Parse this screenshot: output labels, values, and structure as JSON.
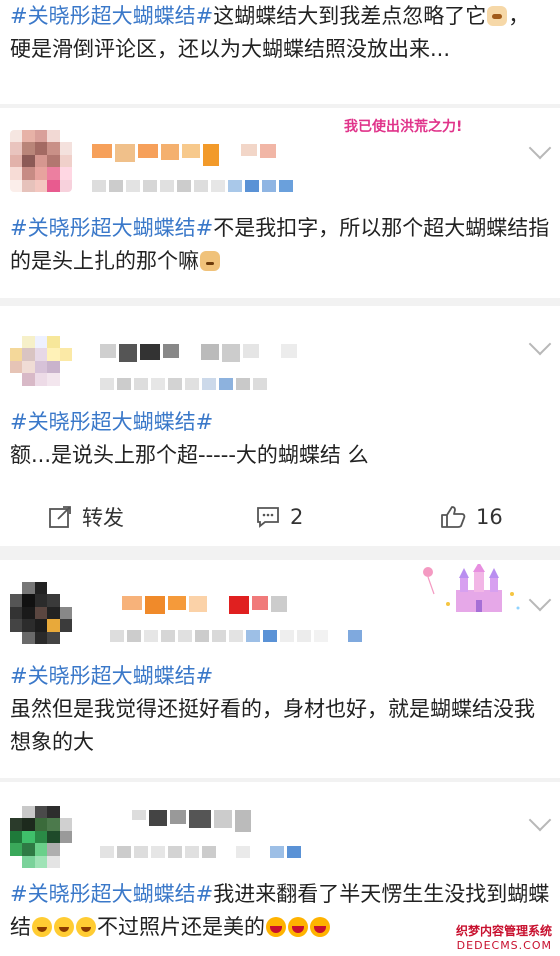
{
  "posts": [
    {
      "hashtag": "#关晓彤超大蝴蝶结#",
      "body": "这蝴蝶结大到我差点忽略了它",
      "body_tail": "，硬是滑倒评论区，还以为大蝴蝶结照没放出来..."
    },
    {
      "badge": "我已使出洪荒之力!",
      "hashtag": "#关晓彤超大蝴蝶结#",
      "body": "不是我扣字，所以那个超大蝴蝶结指的是头上扎的那个嘛"
    },
    {
      "hashtag": "#关晓彤超大蝴蝶结#",
      "body": "额...是说头上那个超-----大的蝴蝶结 么",
      "actions": {
        "repost": "转发",
        "comments": "2",
        "likes": "16"
      }
    },
    {
      "hashtag": "#关晓彤超大蝴蝶结#",
      "body": "虽然但是我觉得还挺好看的，身材也好，就是蝴蝶结没我想象的大"
    },
    {
      "hashtag": "#关晓彤超大蝴蝶结#",
      "body": "我进来翻看了半天愣生生没找到蝴蝶结",
      "body_mid": "不过照片还是美的"
    }
  ],
  "watermark": {
    "line1": "织梦内容管理系统",
    "line2": "DEDECMS.COM"
  },
  "icons": {
    "repost": "repost-icon",
    "comment": "comment-icon",
    "like": "like-icon",
    "more": "chevron-down-icon"
  }
}
